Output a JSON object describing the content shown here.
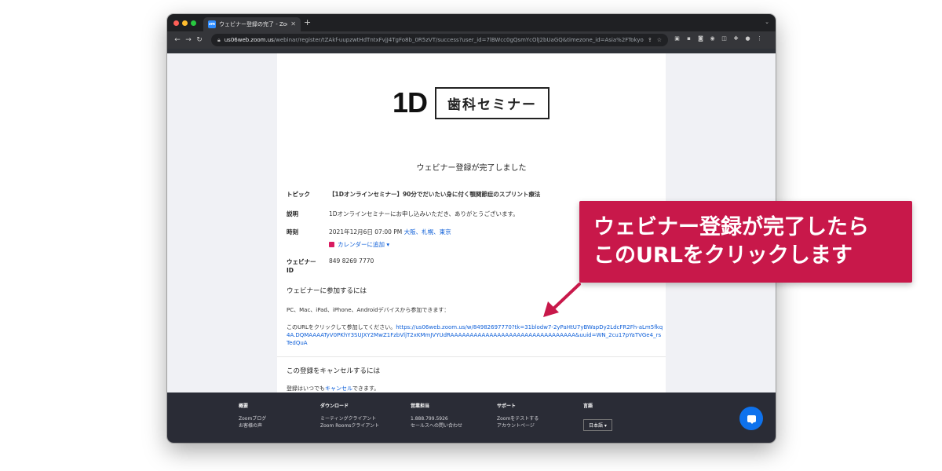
{
  "browser": {
    "tab_title": "ウェビナー登録の完了 - Zoom",
    "tab_favicon_text": "zm",
    "url_host": "us06web.zoom.us",
    "url_path": "/webinar/register/tZAkf-uupzwtHdTntxFvjJ4TgFo8b_0R5zVT/success?user_id=7lBWcc0gQsmYcOlJ2bUaGQ&timezone_id=Asia%2FTokyo"
  },
  "logo": {
    "mark": "1D",
    "box_text": "歯科セミナー"
  },
  "page": {
    "success_title": "ウェビナー登録が完了しました",
    "topic_label": "トピック",
    "topic_value": "【1Dオンラインセミナー】90分でだいたい身に付く顎関節症のスプリント療法",
    "desc_label": "説明",
    "desc_value": "1Dオンラインセミナーにお申し込みいただき、ありがとうございます。",
    "time_label": "時刻",
    "time_value": "2021年12月6日 07:00 PM",
    "time_zones": "大阪、札幌、東京",
    "calendar_link": "カレンダーに追加 ▾",
    "webinar_id_label_1": "ウェビナー",
    "webinar_id_label_2": "ID",
    "webinar_id_value": "849 8269 7770",
    "join_heading": "ウェビナーに参加するには",
    "devices_text": "PC、Mac、iPad、iPhone、Androidデバイスから参加できます：",
    "join_prefix": "このURLをクリックして参加してください。",
    "join_url": "https://us06web.zoom.us/w/84982697770?tk=31blodw7-2yPaHtU7yBWapDy2LdcFR2Fh-aLm5fkq4A.DQMAAAATyV0PKhY3SUJXY2MwZ1FzbVljT2xKMmJVYUdRAAAAAAAAAAAAAAAAAAAAAAAAAAAAAAAA&uuid=WN_2cu17pYaTVGe4_rsTedQuA",
    "cancel_heading": "この登録をキャンセルするには",
    "cancel_prefix": "登録はいつでも",
    "cancel_link": "キャンセル",
    "cancel_suffix": "できます。"
  },
  "footer": {
    "col1_head": "概要",
    "col1_items": [
      "Zoomブログ",
      "お客様の声"
    ],
    "col2_head": "ダウンロード",
    "col2_items": [
      "ミーティングクライアント",
      "Zoom Roomsクライアント"
    ],
    "col3_head": "営業担当",
    "col3_items": [
      "1.888.799.5926",
      "セールスへの問い合わせ"
    ],
    "col4_head": "サポート",
    "col4_items": [
      "Zoomをテストする",
      "アカウントページ"
    ],
    "col5_head": "言語",
    "language": "日本語 ▾"
  },
  "callout": {
    "line1": "ウェビナー登録が完了したら",
    "line2": "このURLをクリックします"
  },
  "colors": {
    "accent_red": "#c8184a",
    "link_blue": "#0e5fd8",
    "zoom_blue": "#0e72ed"
  }
}
